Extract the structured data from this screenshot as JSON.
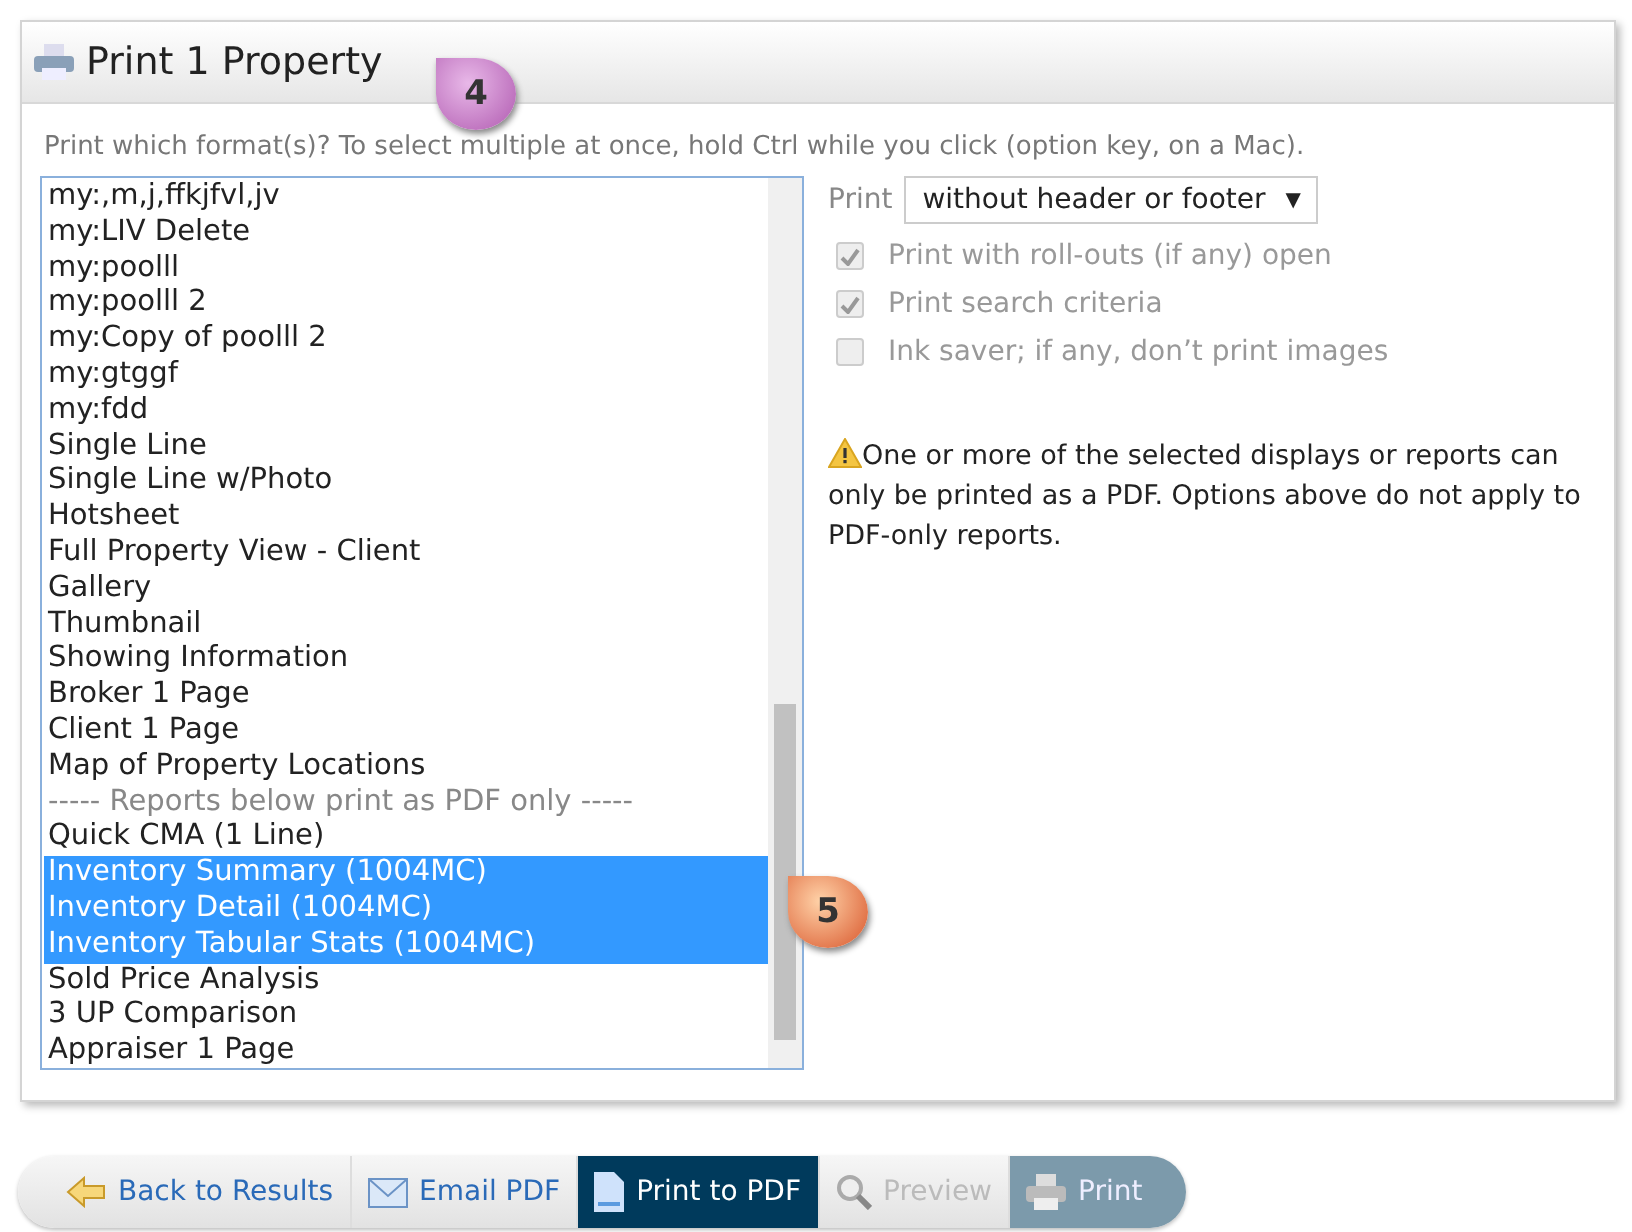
{
  "panel": {
    "title": "Print 1 Property",
    "callout": "4"
  },
  "hint": "Print which format(s)? To select multiple at once, hold Ctrl while you click (option key, on a Mac).",
  "formats": [
    {
      "label": "my:,m,j,ffkjfvl,jv",
      "kind": "option",
      "selected": false
    },
    {
      "label": "my:LIV Delete",
      "kind": "option",
      "selected": false
    },
    {
      "label": "my:poolll",
      "kind": "option",
      "selected": false
    },
    {
      "label": "my:poolll 2",
      "kind": "option",
      "selected": false
    },
    {
      "label": "my:Copy of poolll 2",
      "kind": "option",
      "selected": false
    },
    {
      "label": "my:gtggf",
      "kind": "option",
      "selected": false
    },
    {
      "label": "my:fdd",
      "kind": "option",
      "selected": false
    },
    {
      "label": "Single Line",
      "kind": "option",
      "selected": false
    },
    {
      "label": "Single Line w/Photo",
      "kind": "option",
      "selected": false
    },
    {
      "label": "Hotsheet",
      "kind": "option",
      "selected": false
    },
    {
      "label": "Full Property View - Client",
      "kind": "option",
      "selected": false
    },
    {
      "label": "Gallery",
      "kind": "option",
      "selected": false
    },
    {
      "label": "Thumbnail",
      "kind": "option",
      "selected": false
    },
    {
      "label": "Showing Information",
      "kind": "option",
      "selected": false
    },
    {
      "label": "Broker 1 Page",
      "kind": "option",
      "selected": false
    },
    {
      "label": "Client 1 Page",
      "kind": "option",
      "selected": false
    },
    {
      "label": "Map of Property Locations",
      "kind": "option",
      "selected": false
    },
    {
      "label": "----- Reports below print as PDF only -----",
      "kind": "separator",
      "selected": false
    },
    {
      "label": "Quick CMA (1 Line)",
      "kind": "option",
      "selected": false
    },
    {
      "label": "Inventory Summary (1004MC)",
      "kind": "option",
      "selected": true
    },
    {
      "label": "Inventory Detail (1004MC)",
      "kind": "option",
      "selected": true
    },
    {
      "label": "Inventory Tabular Stats (1004MC)",
      "kind": "option",
      "selected": true
    },
    {
      "label": "Sold Price Analysis",
      "kind": "option",
      "selected": false
    },
    {
      "label": "3 UP Comparison",
      "kind": "option",
      "selected": false
    },
    {
      "label": "Appraiser 1 Page",
      "kind": "option",
      "selected": false
    }
  ],
  "list_callout": "5",
  "print_select": {
    "label": "Print",
    "value": "without header or footer",
    "caret": "▼"
  },
  "options": [
    {
      "label": "Print with roll-outs (if any) open",
      "checked": true,
      "disabled": true
    },
    {
      "label": "Print search criteria",
      "checked": true,
      "disabled": true
    },
    {
      "label": "Ink saver; if any, don’t print images",
      "checked": false,
      "disabled": true
    }
  ],
  "warning": "One or more of the selected displays or reports can only be printed as a PDF. Options above do not apply to PDF-only reports.",
  "toolbar": [
    {
      "label": "Back to Results",
      "selected": false,
      "disabled": false
    },
    {
      "label": "Email PDF",
      "selected": false,
      "disabled": false
    },
    {
      "label": "Print to PDF",
      "selected": true,
      "disabled": false
    },
    {
      "label": "Preview",
      "selected": false,
      "disabled": true
    },
    {
      "label": "Print",
      "selected": false,
      "disabled": true
    }
  ]
}
